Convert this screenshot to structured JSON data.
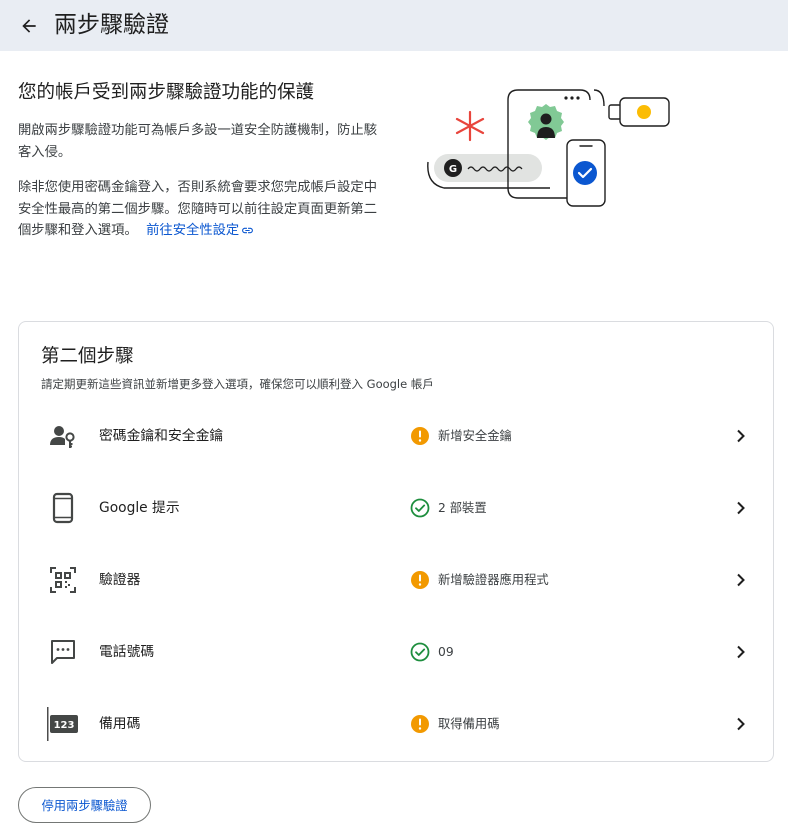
{
  "header": {
    "title": "兩步驟驗證",
    "back_icon": "arrow-back-icon"
  },
  "intro": {
    "heading": "您的帳戶受到兩步驟驗證功能的保護",
    "paragraph1": "開啟兩步驟驗證功能可為帳戶多設一道安全防護機制，防止駭客入侵。",
    "paragraph2": "除非您使用密碼金鑰登入，否則系統會要求您完成帳戶設定中安全性最高的第二個步驟。您隨時可以前往設定頁面更新第二個步驟和登入選項。",
    "link_label": "前往安全性設定",
    "link_icon": "link-icon"
  },
  "second_step": {
    "title": "第二個步驟",
    "subtitle": "請定期更新這些資訊並新增更多登入選項，確保您可以順利登入 Google 帳戶",
    "items": [
      {
        "label": "密碼金鑰和安全金鑰",
        "status": "新增安全金鑰",
        "status_type": "warning",
        "icon": "passkey-icon"
      },
      {
        "label": "Google 提示",
        "status": "2 部裝置",
        "status_type": "ok",
        "icon": "phone-icon"
      },
      {
        "label": "驗證器",
        "status": "新增驗證器應用程式",
        "status_type": "warning",
        "icon": "qr-code-icon"
      },
      {
        "label": "電話號碼",
        "status": "09",
        "status_type": "ok",
        "icon": "sms-icon"
      },
      {
        "label": "備用碼",
        "status": "取得備用碼",
        "status_type": "warning",
        "icon": "backup-code-icon"
      }
    ]
  },
  "footer": {
    "disable_button": "停用兩步驟驗證"
  },
  "colors": {
    "accent": "#0b57d0",
    "warning": "#f29900",
    "ok": "#1e8e3e",
    "header_bg": "#e9edf3"
  }
}
